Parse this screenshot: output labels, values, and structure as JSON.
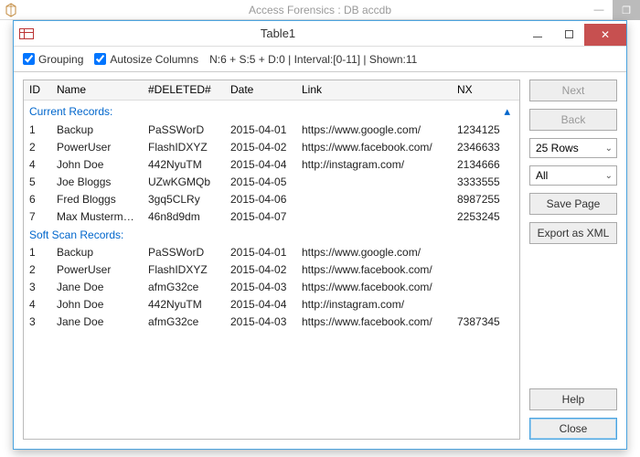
{
  "parent": {
    "title": "Access Forensics : DB accdb"
  },
  "dialog": {
    "title": "Table1"
  },
  "toolbar": {
    "grouping_label": "Grouping",
    "grouping_checked": true,
    "autosize_label": "Autosize Columns",
    "autosize_checked": true,
    "status": "N:6 + S:5 + D:0 | Interval:[0-11] | Shown:11"
  },
  "columns": {
    "id": "ID",
    "name": "Name",
    "deleted": "#DELETED#",
    "date": "Date",
    "link": "Link",
    "nx": "NX"
  },
  "group_current": "Current Records:",
  "group_softscan": "Soft Scan Records:",
  "rows_current": [
    {
      "id": "1",
      "name": "Backup",
      "del": "PaSSWorD",
      "date": "2015-04-01",
      "link": "https://www.google.com/",
      "nx": "1234125"
    },
    {
      "id": "2",
      "name": "PowerUser",
      "del": "FlashIDXYZ",
      "date": "2015-04-02",
      "link": "https://www.facebook.com/",
      "nx": "2346633"
    },
    {
      "id": "4",
      "name": "John Doe",
      "del": "442NyuTM",
      "date": "2015-04-04",
      "link": "http://instagram.com/",
      "nx": "2134666"
    },
    {
      "id": "5",
      "name": "Joe Bloggs",
      "del": "UZwKGMQb",
      "date": "2015-04-05",
      "link": "",
      "nx": "3333555"
    },
    {
      "id": "6",
      "name": "Fred Bloggs",
      "del": "3gq5CLRy",
      "date": "2015-04-06",
      "link": "",
      "nx": "8987255"
    },
    {
      "id": "7",
      "name": "Max Mustermann",
      "del": "46n8d9dm",
      "date": "2015-04-07",
      "link": "",
      "nx": "2253245"
    }
  ],
  "rows_softscan": [
    {
      "id": "1",
      "name": "Backup",
      "del": "PaSSWorD",
      "date": "2015-04-01",
      "link": "https://www.google.com/",
      "nx": ""
    },
    {
      "id": "2",
      "name": "PowerUser",
      "del": "FlashIDXYZ",
      "date": "2015-04-02",
      "link": "https://www.facebook.com/",
      "nx": ""
    },
    {
      "id": "3",
      "name": "Jane Doe",
      "del": "afmG32ce",
      "date": "2015-04-03",
      "link": "https://www.facebook.com/",
      "nx": ""
    },
    {
      "id": "4",
      "name": "John Doe",
      "del": "442NyuTM",
      "date": "2015-04-04",
      "link": "http://instagram.com/",
      "nx": ""
    },
    {
      "id": "3",
      "name": "Jane Doe",
      "del": "afmG32ce",
      "date": "2015-04-03",
      "link": "https://www.facebook.com/",
      "nx": "7387345"
    }
  ],
  "sidebar": {
    "next": "Next",
    "back": "Back",
    "rows_select": "25 Rows",
    "filter_select": "All",
    "save_page": "Save Page",
    "export_xml": "Export as XML",
    "help": "Help",
    "close": "Close"
  }
}
